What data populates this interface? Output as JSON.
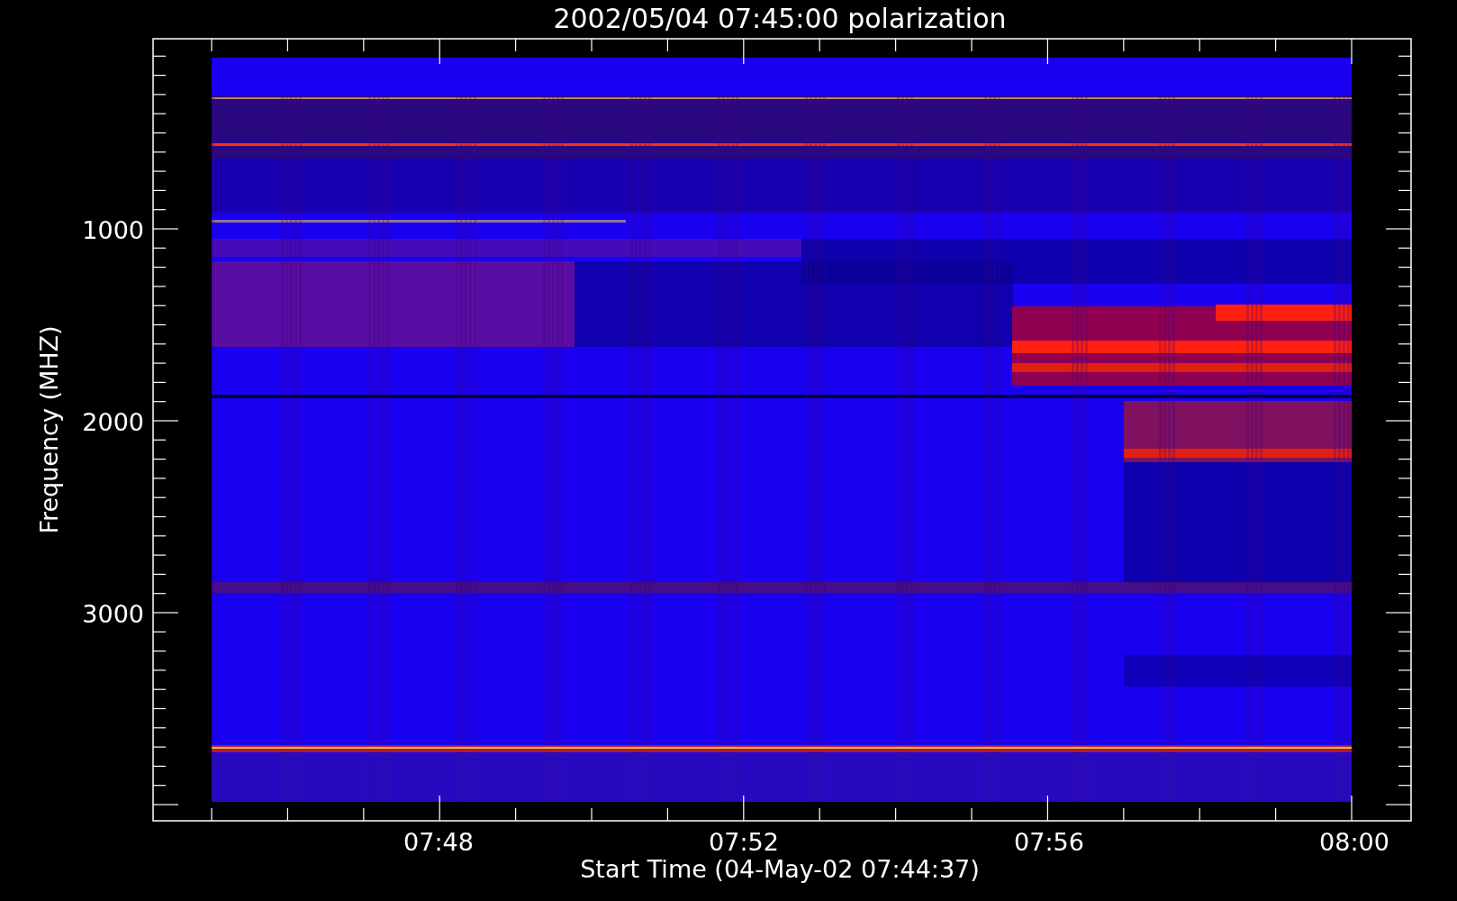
{
  "title": "2002/05/04 07:45:00 polarization",
  "y_axis": {
    "label": "Frequency (MHZ)",
    "tick_labels": [
      "1000",
      "2000",
      "3000"
    ]
  },
  "x_axis": {
    "label": "Start Time (04-May-02 07:44:37)",
    "tick_labels": [
      "07:48",
      "07:52",
      "07:56",
      "08:00"
    ]
  }
}
